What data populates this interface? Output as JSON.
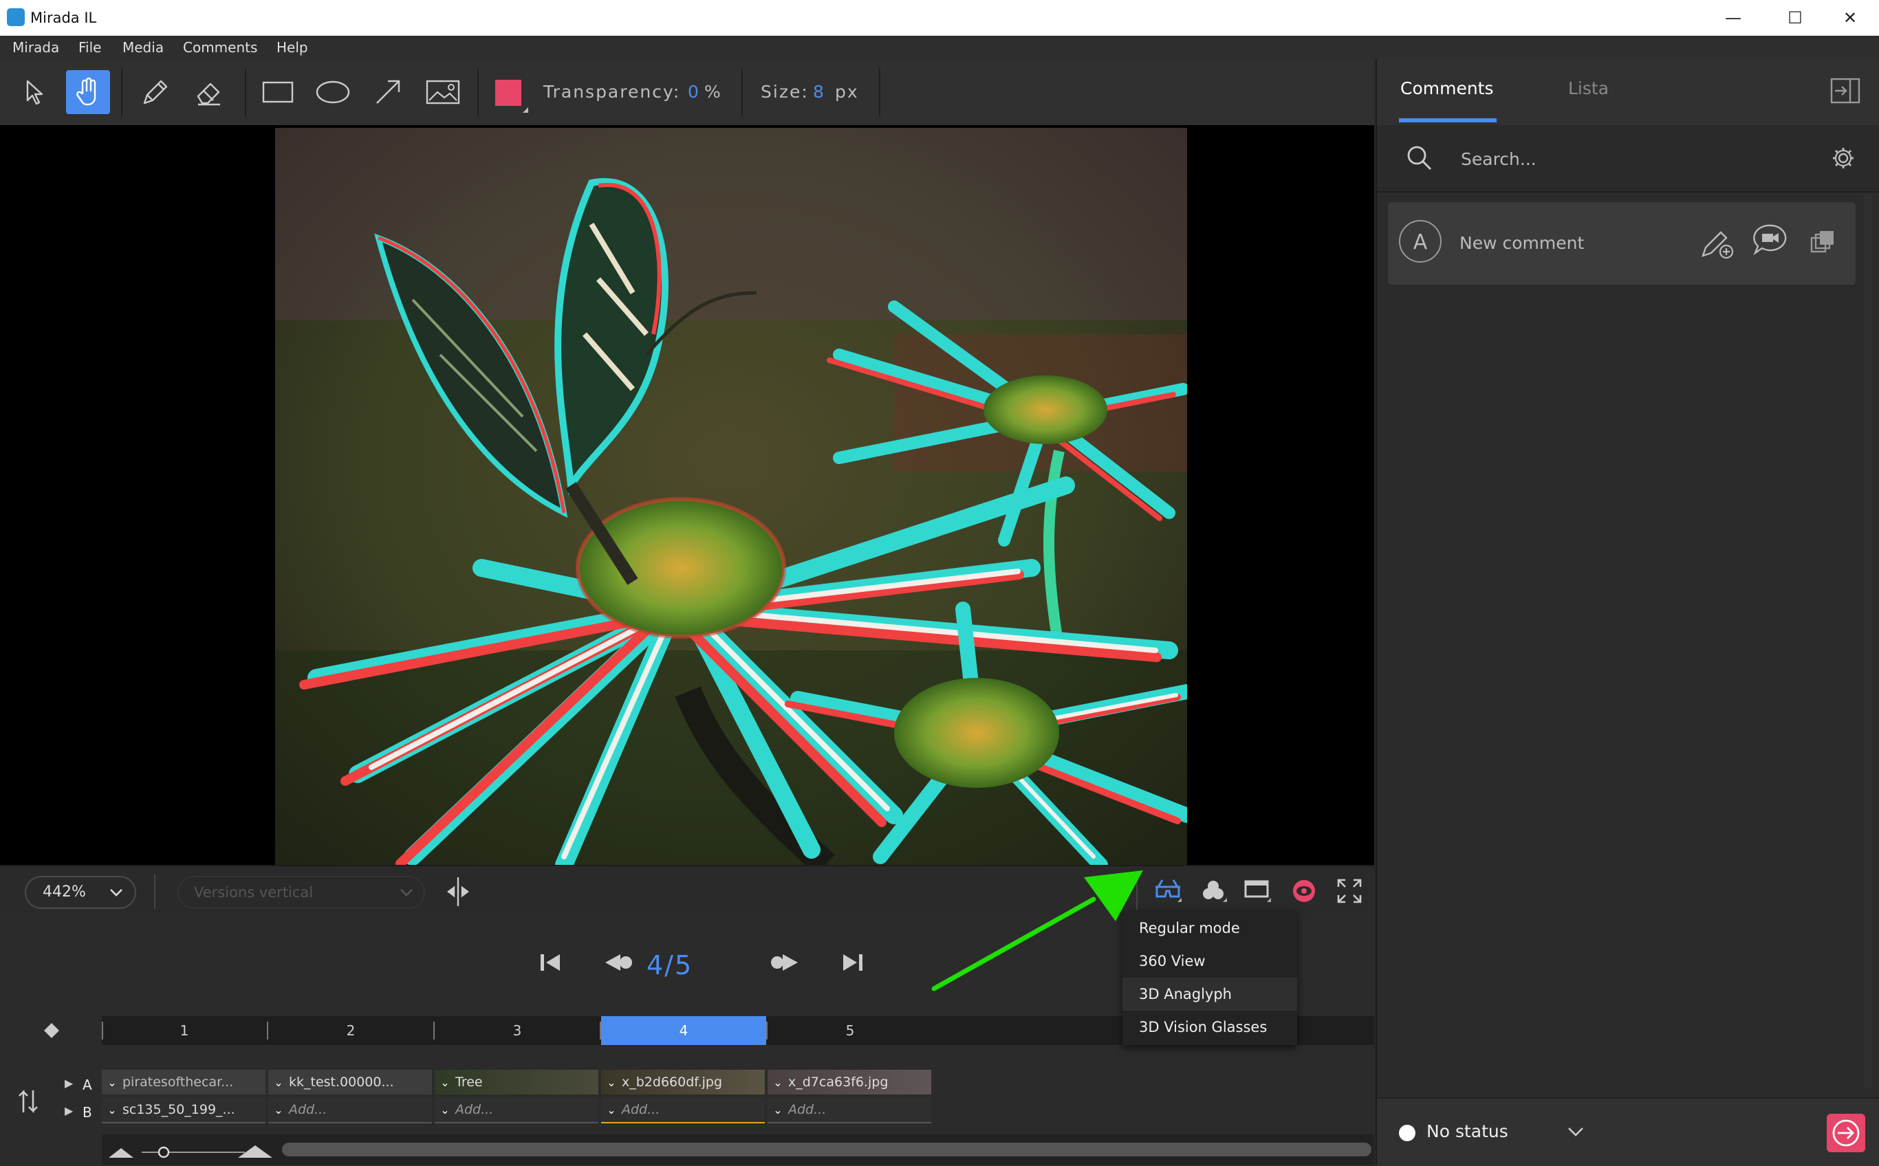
{
  "window": {
    "title": "Mirada IL",
    "controls": [
      "minimize",
      "maximize",
      "close"
    ]
  },
  "menu": [
    "Mirada",
    "File",
    "Media",
    "Comments",
    "Help"
  ],
  "toolbar": {
    "transparency_label": "Transparency:",
    "transparency_value": "0",
    "transparency_unit": "%",
    "size_label": "Size:",
    "size_value": "8",
    "size_unit": "px",
    "color": "#e8456b"
  },
  "viewer": {
    "zoom": "442%",
    "versions_select": "Versions vertical"
  },
  "playback": {
    "frame_counter": "4/5"
  },
  "timeline": {
    "ticks": [
      "1",
      "2",
      "3",
      "4",
      "5"
    ],
    "current": "4"
  },
  "tracks": {
    "a_label": "A",
    "b_label": "B",
    "a": [
      "piratesofthecar...",
      "kk_test.00000...",
      "Tree",
      "x_b2d660df.jpg",
      "x_d7ca63f6.jpg"
    ],
    "b": [
      "sc135_50_199_...",
      "Add...",
      "Add...",
      "Add...",
      "Add..."
    ]
  },
  "dropdown": {
    "items": [
      "Regular mode",
      "360 View",
      "3D Anaglyph",
      "3D Vision Glasses"
    ],
    "highlighted": "3D Anaglyph"
  },
  "panel": {
    "tabs": [
      "Comments",
      "Lista"
    ],
    "active_tab": "Comments",
    "search_placeholder": "Search...",
    "avatar_initial": "A",
    "new_comment": "New comment",
    "status": "No status"
  },
  "colors": {
    "accent": "#4a8cf0",
    "alert": "#e8456b",
    "annotation_arrow": "#1fe000"
  }
}
